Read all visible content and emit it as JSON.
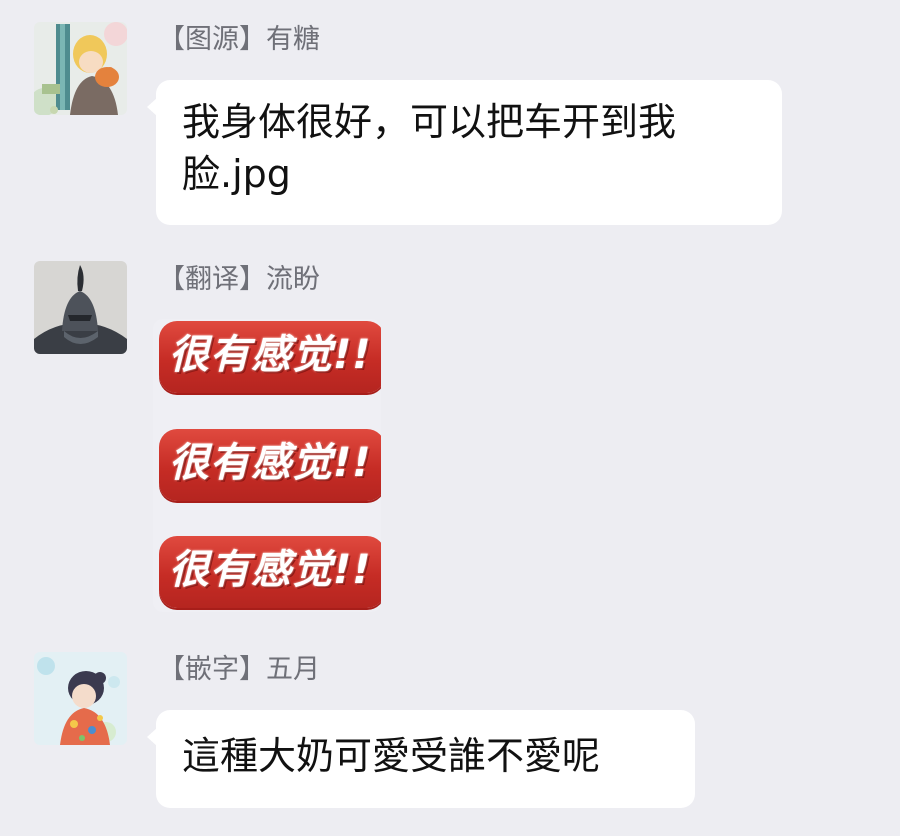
{
  "messages": [
    {
      "sender": "【图源】有糖",
      "avatar": "avatar-anime-boy-with-dog",
      "text_line1": "我身体很好，可以把车开到我",
      "text_line2": "脸.jpg"
    },
    {
      "sender": "【翻译】流盼",
      "avatar": "avatar-dark-knight-helmet",
      "sticker": {
        "lines": [
          "很有感觉!!",
          "很有感觉!!",
          "很有感觉!!"
        ],
        "accent_color": "#c62c25"
      }
    },
    {
      "sender": "【嵌字】五月",
      "avatar": "avatar-anime-girl-kimono",
      "text": "這種大奶可愛受誰不愛呢"
    }
  ],
  "colors": {
    "background": "#ededf2",
    "bubble": "#ffffff",
    "sender_text": "#6f7078"
  }
}
